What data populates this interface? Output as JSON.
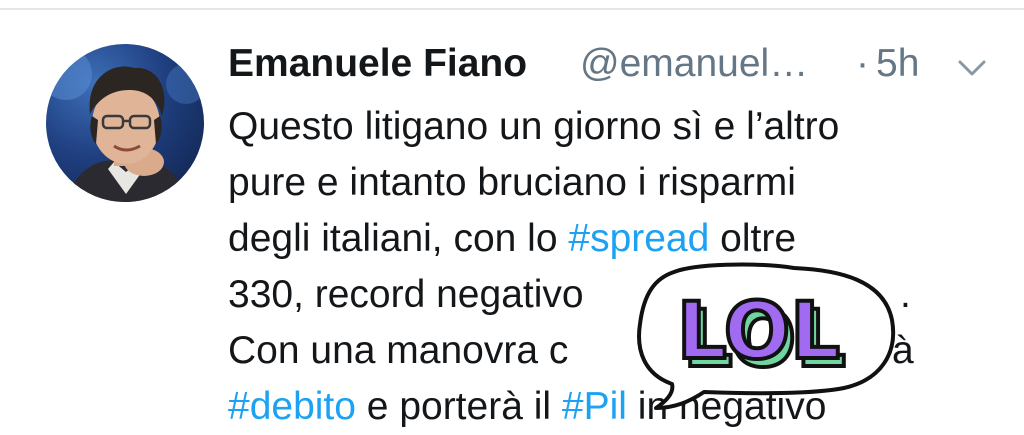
{
  "tweet": {
    "author_name": "Emanuele Fiano",
    "handle": "@emanuel…",
    "separator": "·",
    "time": "5h",
    "chevron_icon": "chevron-down-icon",
    "lines": {
      "l1": "Questo litigano un giorno sì e l’altro",
      "l2": "pure e intanto bruciano i risparmi",
      "l3_a": "degli italiani, con lo ",
      "l3_tag": "#spread",
      "l3_b": " oltre",
      "l4_a": "330, record negativo",
      "l4_tail": ".",
      "l5_a": "Con una manovra c",
      "l5_tail": "à",
      "l6_tag1": "#debito",
      "l6_mid": " e porterà il ",
      "l6_tag2": "#Pil",
      "l6_b": " in negativo"
    }
  },
  "sticker": {
    "text": "LOL",
    "icon": "lol-sticker"
  },
  "colors": {
    "text": "#14171a",
    "secondary": "#657786",
    "link": "#1da1f2",
    "divider": "#e4e7ea",
    "sticker_fill": "#a06bf0",
    "sticker_shadow": "#6fd6a0"
  }
}
